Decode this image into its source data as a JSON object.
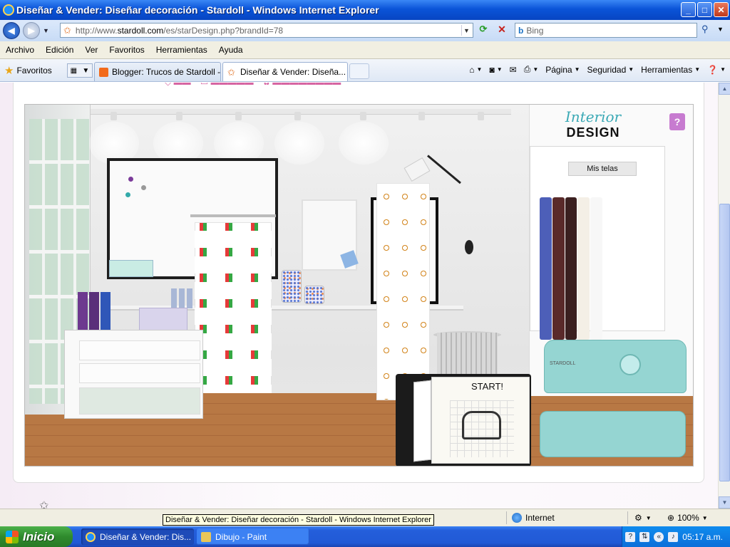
{
  "window": {
    "title": "Diseñar & Vender: Diseñar decoración - Stardoll - Windows Internet Explorer",
    "controls": {
      "minimize": "_",
      "maximize": "□",
      "close": "✕"
    }
  },
  "address_bar": {
    "url_prefix": "http://www.",
    "url_domain": "stardoll.com",
    "url_path": "/es/starDesign.php?brandId=78",
    "search_placeholder": "Bing"
  },
  "menu": [
    "Archivo",
    "Edición",
    "Ver",
    "Favoritos",
    "Herramientas",
    "Ayuda"
  ],
  "tabs_bar": {
    "favorites_label": "Favoritos",
    "tabs": [
      {
        "label": "Blogger: Trucos de Stardoll - ...",
        "icon": "blogger-icon",
        "color": "#f26a1b",
        "active": false
      },
      {
        "label": "Diseñar & Vender: Diseña...",
        "icon": "star-icon",
        "color": "#e06c1c",
        "active": true
      }
    ],
    "commands": {
      "page": "Página",
      "security": "Seguridad",
      "tools": "Herramientas"
    }
  },
  "game": {
    "logo_line1": "Interior",
    "logo_line2": "DESIGN",
    "help_label": "?",
    "fabrics_label": "Mis telas",
    "start_label": "START!",
    "sewing_brand": "STARDOLL",
    "colors": {
      "wood_floor": "#b87844",
      "machine": "#95d5d2",
      "logo_teal": "#3aa9b5",
      "help_purple": "#c77bd0"
    }
  },
  "status_bar": {
    "tooltip": "Diseñar & Vender: Diseñar decoración - Stardoll - Windows Internet Explorer",
    "zone": "Internet",
    "zoom": "100%"
  },
  "taskbar": {
    "start_label": "Inicio",
    "items": [
      {
        "label": "Diseñar & Vender: Dis...",
        "active": true
      },
      {
        "label": "Dibujo - Paint",
        "active": false
      }
    ],
    "clock": "05:17 a.m."
  }
}
